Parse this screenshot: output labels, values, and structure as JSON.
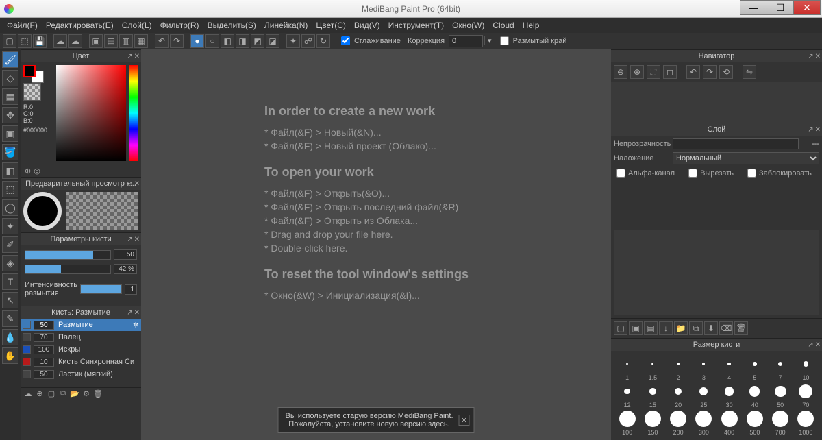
{
  "title": "MediBang Paint Pro (64bit)",
  "menu": [
    "Файл(F)",
    "Редактировать(E)",
    "Слой(L)",
    "Фильтр(R)",
    "Выделить(S)",
    "Линейка(N)",
    "Цвет(C)",
    "Вид(V)",
    "Инструмент(T)",
    "Окно(W)",
    "Cloud",
    "Help"
  ],
  "toolbar": {
    "smoothing": "Сглаживание",
    "correction": "Коррекция",
    "correction_value": "0",
    "blurry_edge": "Размытый край"
  },
  "panels": {
    "color": {
      "title": "Цвет",
      "rgb": "R:0\nG:0\nB:0",
      "hex": "#000000"
    },
    "preview": {
      "title": "Предварительный просмотр к..."
    },
    "brushParams": {
      "title": "Параметры кисти",
      "size": "50",
      "opacity": "42 %",
      "blurLabel": "Интенсивность размытия",
      "blurValue": "1"
    },
    "brushList": {
      "title": "Кисть: Размытие",
      "items": [
        {
          "size": "50",
          "name": "Размытие",
          "color": "#3d7ab8",
          "sel": true,
          "star": true
        },
        {
          "size": "70",
          "name": "Палец",
          "color": "#444"
        },
        {
          "size": "100",
          "name": "Искры",
          "color": "#1a4fb8"
        },
        {
          "size": "10",
          "name": "Кисть Синхронная Си",
          "color": "#b81a1a"
        },
        {
          "size": "50",
          "name": "Ластик (мягкий)",
          "color": "#444"
        }
      ]
    },
    "navigator": {
      "title": "Навигатор"
    },
    "layer": {
      "title": "Слой",
      "opacity": "Непрозрачность",
      "opacityVal": "---",
      "blend": "Наложение",
      "blendMode": "Нормальный",
      "alpha": "Альфа-канал",
      "clip": "Вырезать",
      "lock": "Заблокировать"
    },
    "brushSizes": {
      "title": "Размер кисти",
      "sizes": [
        1,
        1.5,
        2,
        3,
        4,
        5,
        7,
        10,
        12,
        15,
        20,
        25,
        30,
        40,
        50,
        70,
        100,
        150,
        200,
        300,
        400,
        500,
        700,
        1000
      ]
    }
  },
  "canvas": {
    "h1": "In order to create a new work",
    "l1": "* Файл(&F) > Новый(&N)...",
    "l2": "* Файл(&F) > Новый проект (Облако)...",
    "h2": "To open your work",
    "l3": "* Файл(&F) > Открыть(&O)...",
    "l4": "* Файл(&F) > Открыть последний файл(&R)",
    "l5": "* Файл(&F) > Открыть из Облака...",
    "l6": "* Drag and drop your file here.",
    "l7": "* Double-click here.",
    "h3": "To reset the tool window's settings",
    "l8": "* Окно(&W) > Инициализация(&I)...",
    "notice1": "Вы используете старую версию MediBang Paint.",
    "notice2": "Пожалуйста, установите новую версию здесь."
  }
}
